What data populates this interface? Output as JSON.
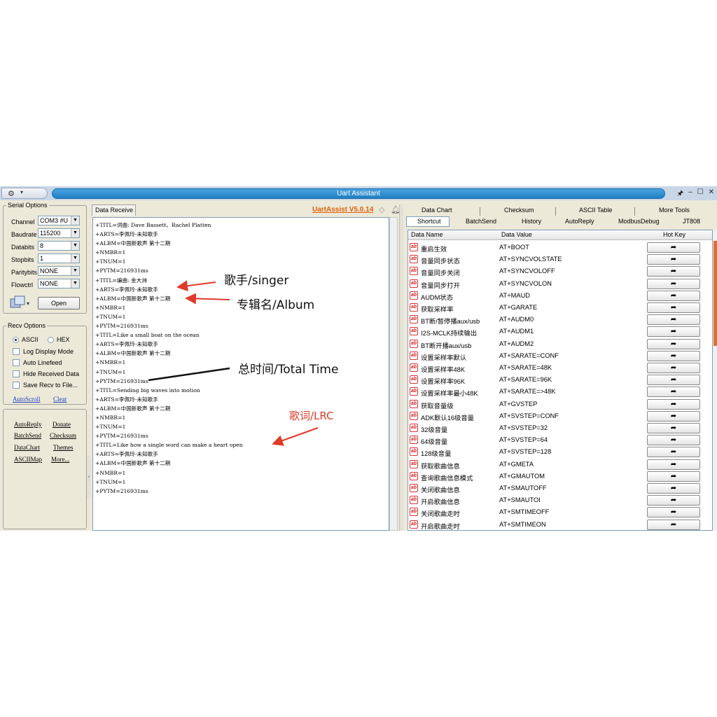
{
  "window": {
    "title": "Uart Assistant",
    "controls": [
      "🖈",
      "–",
      "☐",
      "✕"
    ]
  },
  "serial_options": {
    "legend": "Serial Options",
    "channel_label": "Channel",
    "channel_value": "COM3 #U",
    "baudrate_label": "Baudrate",
    "baudrate_value": "115200",
    "databits_label": "Databits",
    "databits_value": "8",
    "stopbits_label": "Stopbits",
    "stopbits_value": "1",
    "paritybits_label": "Paritybits",
    "paritybits_value": "NONE",
    "flowctrl_label": "Flowctrl",
    "flowctrl_value": "NONE",
    "open_label": "Open"
  },
  "recv_options": {
    "legend": "Recv Options",
    "ascii_label": "ASCII",
    "hex_label": "HEX",
    "log_display": "Log Display Mode",
    "auto_linefeed": "Auto Linefeed",
    "hide_received": "Hide Received Data",
    "save_recv": "Save Recv to File...",
    "autoscroll": "AutoScroll",
    "clear": "Clear"
  },
  "tools_links": {
    "autoreply": "AutoReply",
    "donate": "Donate",
    "batchsend": "BatchSend",
    "checksum": "Checksum",
    "datachart": "DataChart",
    "themes": "Themes",
    "asciimap": "ASCIIMap",
    "more": "More..."
  },
  "receive": {
    "tab_label": "Data Receive",
    "version": "UartAssist V5.0.14",
    "lines": [
      "+TITL=词曲: Dave Bassett、Rachel Platten",
      "+ARTS=李佩玲-未知歌手",
      "+ALBM=中国新歌声 第十二期",
      "+NMBR=1",
      "+TNUM=1",
      "+PYTM=216931ms",
      "+TITL=编曲: 金大洲",
      "+ARTS=李佩玲-未知歌手",
      "+ALBM=中国新歌声 第十二期",
      "+NMBR=1",
      "+TNUM=1",
      "+PYTM=216931ms",
      "+TITL=Like a small boat on the ocean",
      "+ARTS=李佩玲-未知歌手",
      "+ALBM=中国新歌声 第十二期",
      "+NMBR=1",
      "+TNUM=1",
      "+PYTM=216931ms",
      "+TITL=Sending big waves into motion",
      "+ARTS=李佩玲-未知歌手",
      "+ALBM=中国新歌声 第十二期",
      "+NMBR=1",
      "+TNUM=1",
      "+PYTM=216931ms",
      "+TITL=Like how a single word can make a heart open",
      "+ARTS=李佩玲-未知歌手",
      "+ALBM=中国新歌声 第十二期",
      "+NMBR=1",
      "+TNUM=1",
      "+PYTM=216931ms"
    ]
  },
  "annotations": {
    "singer": "歌手/singer",
    "album": "专辑名/Album",
    "total_time": "总时间/Total Time",
    "lrc": "歌词/LRC"
  },
  "right_tabs": {
    "row1": [
      "Data Chart",
      "Checksum",
      "ASCII Table",
      "More Tools"
    ],
    "row2": [
      "Shortcut",
      "BatchSend",
      "History",
      "AutoReply",
      "ModbusDebug",
      "JT808"
    ]
  },
  "shortcut_table": {
    "headers": [
      "Data Name",
      "Data Value",
      "Hot Key"
    ],
    "rows": [
      {
        "name": "重启生效",
        "value": "AT+BOOT"
      },
      {
        "name": "音量同步状态",
        "value": "AT+SYNCVOLSTATE"
      },
      {
        "name": "音量同步关闭",
        "value": "AT+SYNCVOLOFF"
      },
      {
        "name": "音量同步打开",
        "value": "AT+SYNCVOLON"
      },
      {
        "name": "AUDM状态",
        "value": "AT+MAUD"
      },
      {
        "name": "获取采样率",
        "value": "AT+GARATE"
      },
      {
        "name": "BT断/暂停播aux/usb",
        "value": "AT+AUDM0"
      },
      {
        "name": "I2S-MCLK持续输出",
        "value": "AT+AUDM1"
      },
      {
        "name": "BT断开播aux/usb",
        "value": "AT+AUDM2"
      },
      {
        "name": "设置采样率默认",
        "value": "AT+SARATE=CONF"
      },
      {
        "name": "设置采样率48K",
        "value": "AT+SARATE=48K"
      },
      {
        "name": "设置采样率96K",
        "value": "AT+SARATE=96K"
      },
      {
        "name": "设置采样率最小48K",
        "value": "AT+SARATE=>48K"
      },
      {
        "name": "获取音量级",
        "value": "AT+GVSTEP"
      },
      {
        "name": "ADK默认16级音量",
        "value": "AT+SVSTEP=CONF"
      },
      {
        "name": "32级音量",
        "value": "AT+SVSTEP=32"
      },
      {
        "name": "64级音量",
        "value": "AT+SVSTEP=64"
      },
      {
        "name": "128级音量",
        "value": "AT+SVSTEP=128"
      },
      {
        "name": "获取歌曲信息",
        "value": "AT+GMETA"
      },
      {
        "name": "查询歌曲信息模式",
        "value": "AT+GMAUTOM"
      },
      {
        "name": "关闭歌曲信息",
        "value": "AT+SMAUTOFF"
      },
      {
        "name": "开启歌曲信息",
        "value": "AT+SMAUTOI"
      },
      {
        "name": "关闭歌曲走时",
        "value": "AT+SMTIMEOFF"
      },
      {
        "name": "开启歌曲走时",
        "value": "AT+SMTIMEON"
      }
    ]
  },
  "colors": {
    "accent_orange": "#e0600a",
    "annotation_red": "#d93a2b",
    "title_blue": "#1f7fc4"
  }
}
